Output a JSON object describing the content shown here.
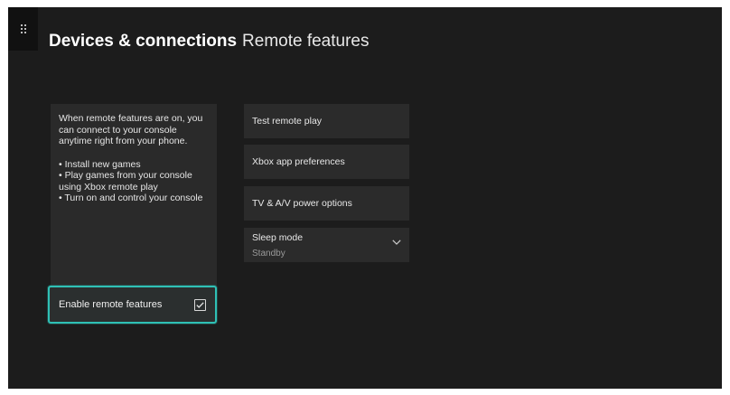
{
  "header": {
    "section": "Devices & connections",
    "page": "Remote features"
  },
  "guide_button": {
    "icon": "grip-dots-icon"
  },
  "info_panel": {
    "intro": "When remote features are on, you can connect to your console anytime right from your phone.",
    "bullets": [
      "• Install new games",
      "• Play games from your console using Xbox remote play",
      "• Turn on and control your console"
    ]
  },
  "enable_remote": {
    "label": "Enable remote features",
    "checked": true,
    "icon": "checkbox-checked-icon"
  },
  "menu": {
    "items": [
      {
        "label": "Test remote play"
      },
      {
        "label": "Xbox app preferences"
      },
      {
        "label": "TV & A/V power options"
      }
    ],
    "sleep_mode": {
      "label": "Sleep mode",
      "value": "Standby",
      "icon": "chevron-down-icon"
    }
  },
  "colors": {
    "background": "#1c1c1c",
    "panel": "#2a2a2a",
    "focus": "#2fc0b5"
  }
}
